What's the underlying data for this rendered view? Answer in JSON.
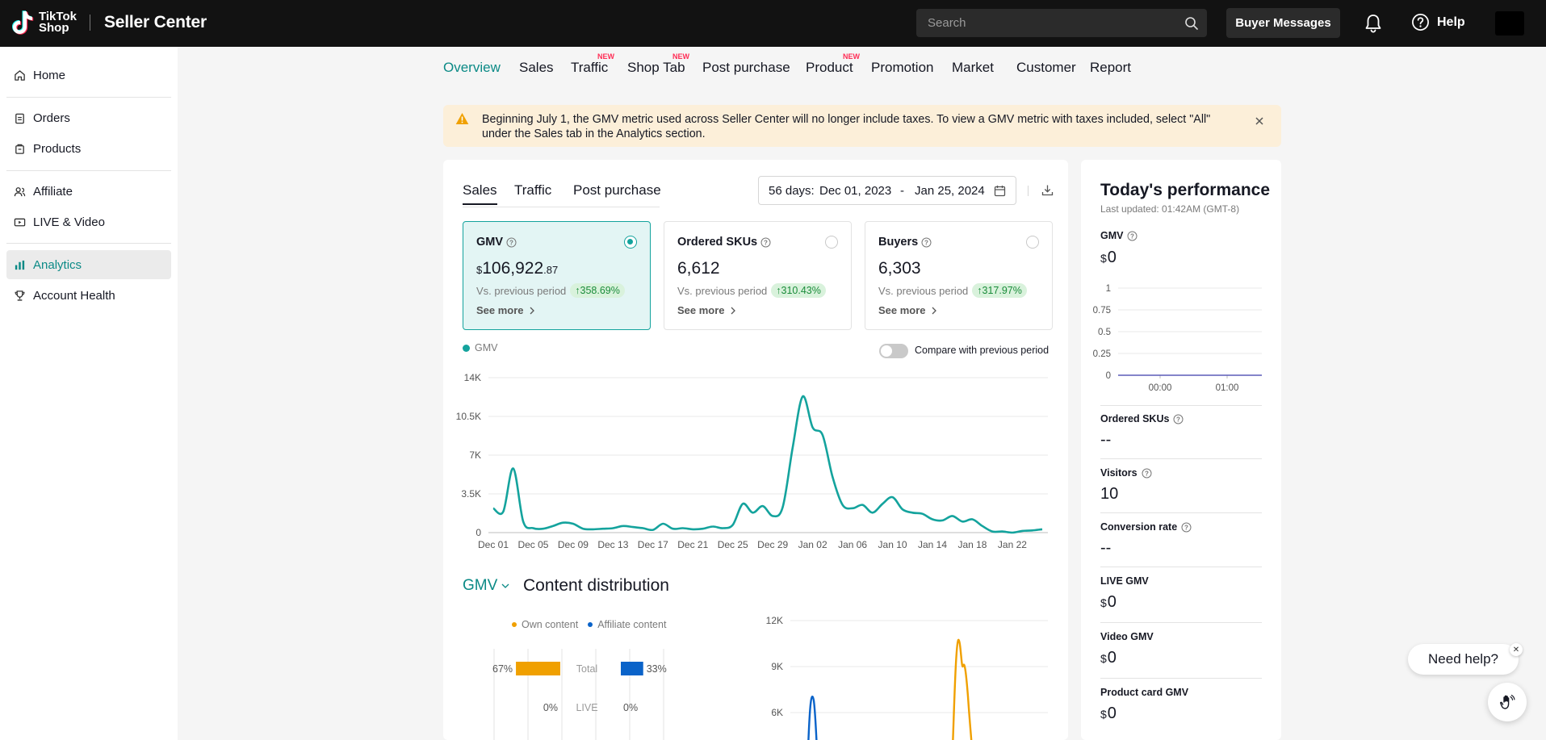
{
  "header": {
    "logo_line1": "TikTok",
    "logo_line2": "Shop",
    "app_title": "Seller Center",
    "search_placeholder": "Search",
    "buyer_messages": "Buyer Messages",
    "help": "Help"
  },
  "sidebar": {
    "items": [
      {
        "label": "Home",
        "icon": "home-icon"
      },
      {
        "label": "Orders",
        "icon": "clipboard-icon"
      },
      {
        "label": "Products",
        "icon": "box-icon"
      },
      {
        "label": "Affiliate",
        "icon": "users-icon"
      },
      {
        "label": "LIVE & Video",
        "icon": "video-icon"
      },
      {
        "label": "Analytics",
        "icon": "bar-chart-icon",
        "active": true
      },
      {
        "label": "Account Health",
        "icon": "trophy-icon"
      }
    ]
  },
  "tabs": [
    {
      "label": "Overview",
      "active": true
    },
    {
      "label": "Sales"
    },
    {
      "label": "Traffic",
      "badge": "NEW"
    },
    {
      "label": "Shop Tab",
      "badge": "NEW"
    },
    {
      "label": "Post purchase"
    },
    {
      "label": "Product",
      "badge": "NEW"
    },
    {
      "label": "Promotion"
    },
    {
      "label": "Market"
    },
    {
      "label": "Customer"
    },
    {
      "label": "Report"
    }
  ],
  "alert": {
    "text": "Beginning July 1, the GMV metric used across Seller Center will no longer include taxes. To view a GMV metric with taxes included, select \"All\" under the Sales tab in the Analytics section."
  },
  "main": {
    "subtabs": [
      "Sales",
      "Traffic",
      "Post purchase"
    ],
    "date_range": {
      "label": "56 days:",
      "start": "Dec 01, 2023",
      "separator": "-",
      "end": "Jan 25, 2024"
    },
    "metrics": [
      {
        "name": "GMV",
        "currency": "$",
        "value": "106,922",
        "decimals": ".87",
        "vs_label": "Vs. previous period",
        "change": "358.69%",
        "see_more": "See more",
        "selected": true
      },
      {
        "name": "Ordered SKUs",
        "currency": "",
        "value": "6,612",
        "decimals": "",
        "vs_label": "Vs. previous period",
        "change": "310.43%",
        "see_more": "See more",
        "selected": false
      },
      {
        "name": "Buyers",
        "currency": "",
        "value": "6,303",
        "decimals": "",
        "vs_label": "Vs. previous period",
        "change": "317.97%",
        "see_more": "See more",
        "selected": false
      }
    ],
    "legend": "GMV",
    "compare_label": "Compare with previous period",
    "compare_on": false,
    "content_section": {
      "metric_selector": "GMV",
      "title": "Content distribution",
      "legend_own": "Own content",
      "legend_affiliate": "Affiliate content"
    }
  },
  "chart_data": [
    {
      "type": "line",
      "id": "gmv-trend",
      "series": [
        {
          "name": "GMV",
          "color": "#14a39d"
        }
      ],
      "x": [
        "Dec 01",
        "Dec 02",
        "Dec 03",
        "Dec 04",
        "Dec 05",
        "Dec 06",
        "Dec 07",
        "Dec 08",
        "Dec 09",
        "Dec 10",
        "Dec 11",
        "Dec 12",
        "Dec 13",
        "Dec 14",
        "Dec 15",
        "Dec 16",
        "Dec 17",
        "Dec 18",
        "Dec 19",
        "Dec 20",
        "Dec 21",
        "Dec 22",
        "Dec 23",
        "Dec 24",
        "Dec 25",
        "Dec 26",
        "Dec 27",
        "Dec 28",
        "Dec 29",
        "Dec 30",
        "Dec 31",
        "Jan 01",
        "Jan 02",
        "Jan 03",
        "Jan 04",
        "Jan 05",
        "Jan 06",
        "Jan 07",
        "Jan 08",
        "Jan 09",
        "Jan 10",
        "Jan 11",
        "Jan 12",
        "Jan 13",
        "Jan 14",
        "Jan 15",
        "Jan 16",
        "Jan 17",
        "Jan 18",
        "Jan 19",
        "Jan 20",
        "Jan 21",
        "Jan 22",
        "Jan 23",
        "Jan 24",
        "Jan 25"
      ],
      "values": [
        2200,
        1900,
        5800,
        1000,
        400,
        350,
        600,
        900,
        800,
        350,
        300,
        350,
        400,
        600,
        500,
        400,
        250,
        800,
        350,
        400,
        300,
        350,
        550,
        400,
        700,
        2600,
        1800,
        2400,
        1500,
        2300,
        7700,
        12300,
        9500,
        8800,
        5000,
        2500,
        2200,
        2500,
        1800,
        2600,
        3200,
        2100,
        1800,
        1700,
        1200,
        1100,
        1500,
        1000,
        1200,
        600,
        100,
        100,
        0,
        150,
        200,
        300
      ],
      "yticks": [
        "0",
        "3.5K",
        "7K",
        "10.5K",
        "14K"
      ],
      "ylim": [
        0,
        14000
      ],
      "xticks": [
        "Dec 01",
        "Dec 05",
        "Dec 09",
        "Dec 13",
        "Dec 17",
        "Dec 21",
        "Dec 25",
        "Dec 29",
        "Jan 02",
        "Jan 06",
        "Jan 10",
        "Jan 14",
        "Jan 18",
        "Jan 22"
      ],
      "grid": true
    },
    {
      "type": "bar",
      "id": "content-distribution",
      "categories": [
        "Total",
        "LIVE"
      ],
      "series": [
        {
          "name": "Own content",
          "color": "#f0a000",
          "values": [
            67,
            0
          ],
          "labels": [
            "67%",
            "0%"
          ]
        },
        {
          "name": "Affiliate content",
          "color": "#0a63c9",
          "values": [
            33,
            0
          ],
          "labels": [
            "33%",
            "0%"
          ]
        }
      ]
    },
    {
      "type": "line",
      "id": "content-trend",
      "series": [
        {
          "name": "Own content",
          "color": "#f0a000"
        },
        {
          "name": "Affiliate content",
          "color": "#0a63c9"
        }
      ],
      "yticks": [
        "6K",
        "9K",
        "12K"
      ]
    },
    {
      "type": "line",
      "id": "today-gmv",
      "series": [
        {
          "name": "GMV",
          "color": "#5b5bb8",
          "values": [
            0,
            0
          ]
        }
      ],
      "x": [
        "00:00",
        "01:00"
      ],
      "yticks": [
        "0",
        "0.25",
        "0.5",
        "0.75",
        "1"
      ],
      "ylim": [
        0,
        1
      ],
      "grid": true
    }
  ],
  "today": {
    "title": "Today's performance",
    "updated": "Last updated: 01:42AM (GMT-8)",
    "gmv": {
      "label": "GMV",
      "currency": "$",
      "value": "0"
    },
    "kpis": [
      {
        "label": "Ordered SKUs",
        "value": "--",
        "currency": "",
        "info": true
      },
      {
        "label": "Visitors",
        "value": "10",
        "currency": "",
        "info": true
      },
      {
        "label": "Conversion rate",
        "value": "--",
        "currency": "",
        "info": true
      },
      {
        "label": "LIVE GMV",
        "value": "0",
        "currency": "$",
        "info": false
      },
      {
        "label": "Video GMV",
        "value": "0",
        "currency": "$",
        "info": false
      },
      {
        "label": "Product card GMV",
        "value": "0",
        "currency": "$",
        "info": false
      }
    ]
  },
  "need_help": {
    "label": "Need help?"
  }
}
